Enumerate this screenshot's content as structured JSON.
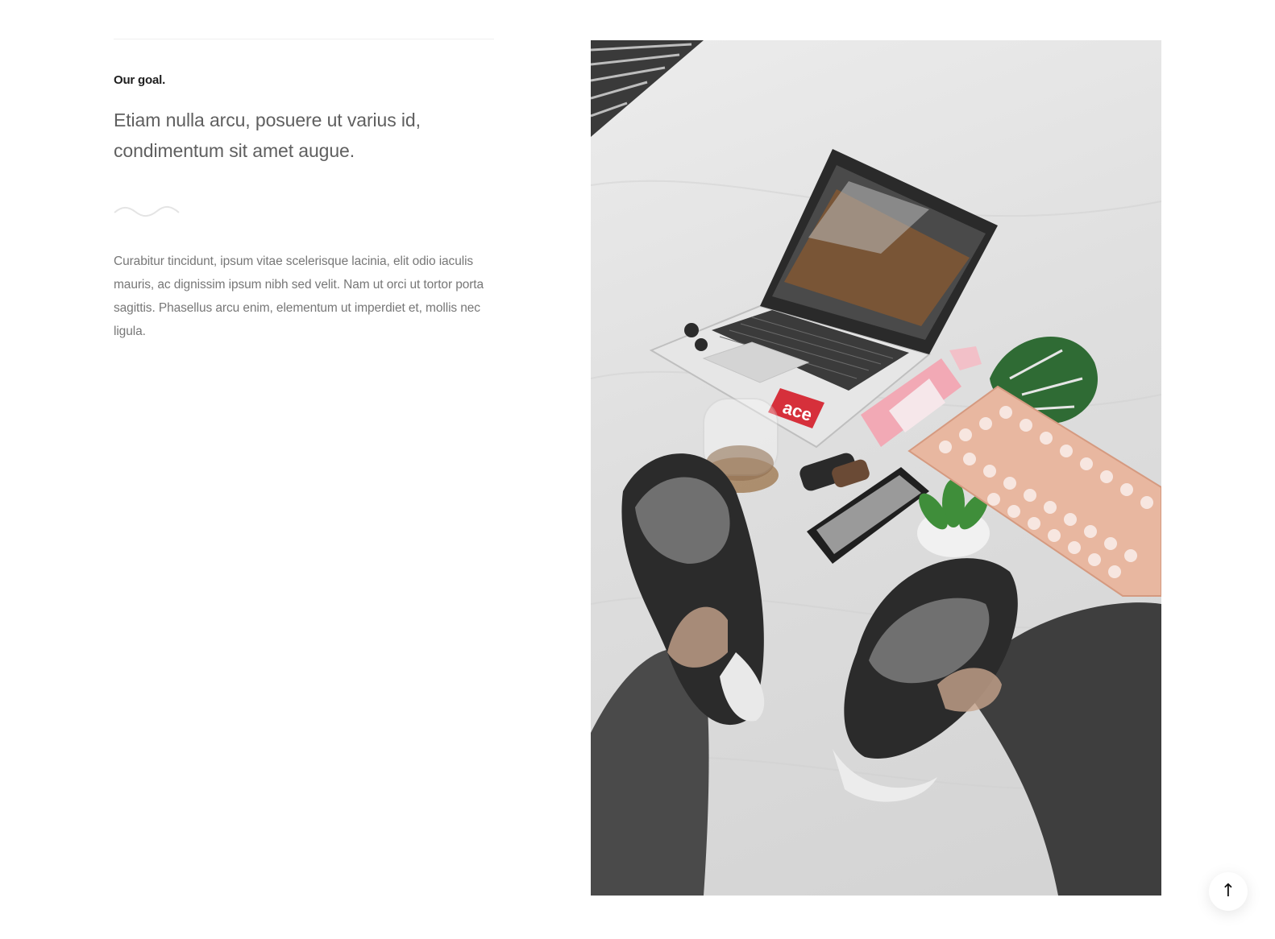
{
  "section": {
    "eyebrow": "Our goal.",
    "lead": "Etiam nulla arcu, posuere ut varius id, condimentum sit amet augue.",
    "body": "Curabitur tincidunt, ipsum vitae scelerisque lacinia, elit odio iaculis mauris, ac dignissim ipsum nibh sed velit. Nam ut orci ut tortor porta sagittis. Phasellus arcu enim, elementum ut imperdiet et, mollis nec ligula."
  },
  "photo": {
    "sticker_text": "ace"
  },
  "scroll_top": {
    "icon": "arrow-up-icon",
    "glyph": "↑"
  }
}
